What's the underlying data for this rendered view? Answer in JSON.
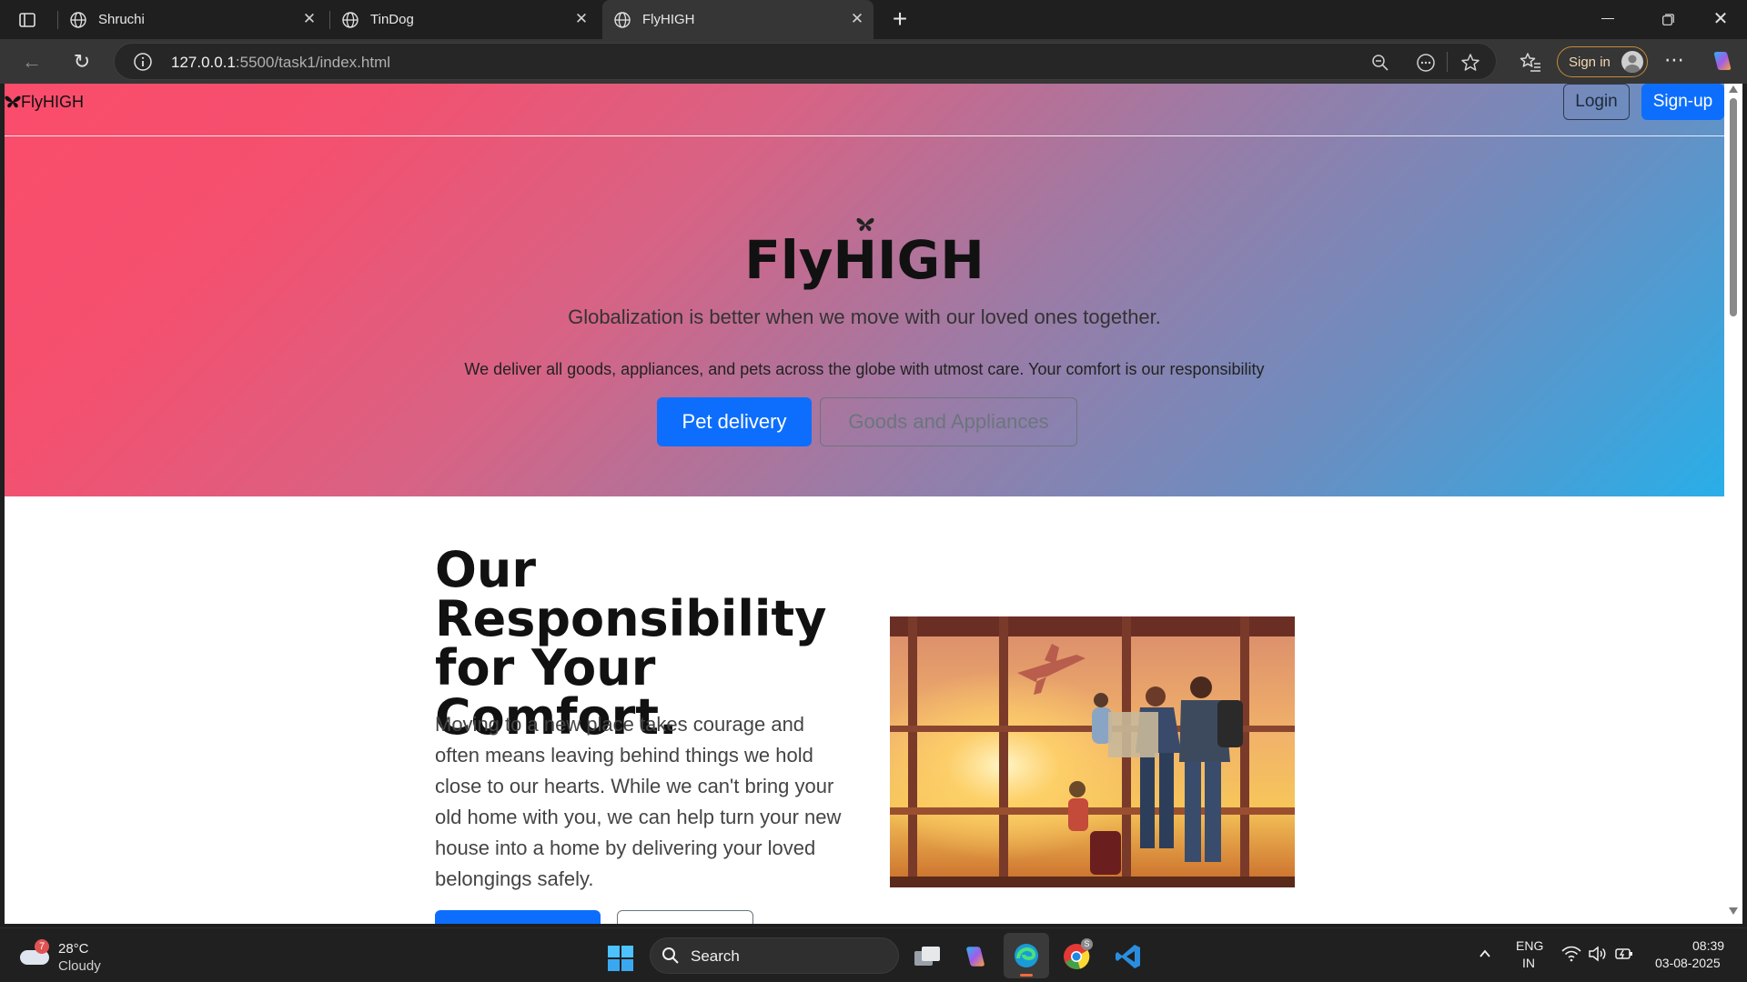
{
  "browser": {
    "tabs": [
      {
        "title": "Shruchi",
        "active": false
      },
      {
        "title": "TinDog",
        "active": false
      },
      {
        "title": "FlyHIGH",
        "active": true
      }
    ],
    "url_host": "127.0.0.1",
    "url_path": ":5500/task1/index.html",
    "signin_label": "Sign in"
  },
  "page": {
    "nav": {
      "brand": "FlyHIGH",
      "login_label": "Login",
      "signup_label": "Sign-up"
    },
    "hero": {
      "title": "FlyHIGH",
      "subtitle": "Globalization is better when we move with our loved ones together.",
      "description": "We deliver all goods, appliances, and pets across the globe with utmost care. Your comfort is our responsibility",
      "primary_button": "Pet delivery",
      "secondary_button": "Goods and Appliances"
    },
    "section": {
      "title": "Our Responsibility for Your Comfort.",
      "text": "Moving to a new place takes courage and often means leaving behind things we hold close to our hearts. While we can't bring your old home with you, we can help turn your new house into a home by delivering your loved belongings safely."
    },
    "colors": {
      "hero_start": "#fb4c6b",
      "hero_end": "#29aee8",
      "primary": "#0d6efd",
      "secondary": "#6c757d"
    }
  },
  "taskbar": {
    "weather_temp": "28°C",
    "weather_desc": "Cloudy",
    "weather_badge": "7",
    "search_label": "Search",
    "lang_top": "ENG",
    "lang_bottom": "IN",
    "time": "08:39",
    "date": "03-08-2025"
  }
}
